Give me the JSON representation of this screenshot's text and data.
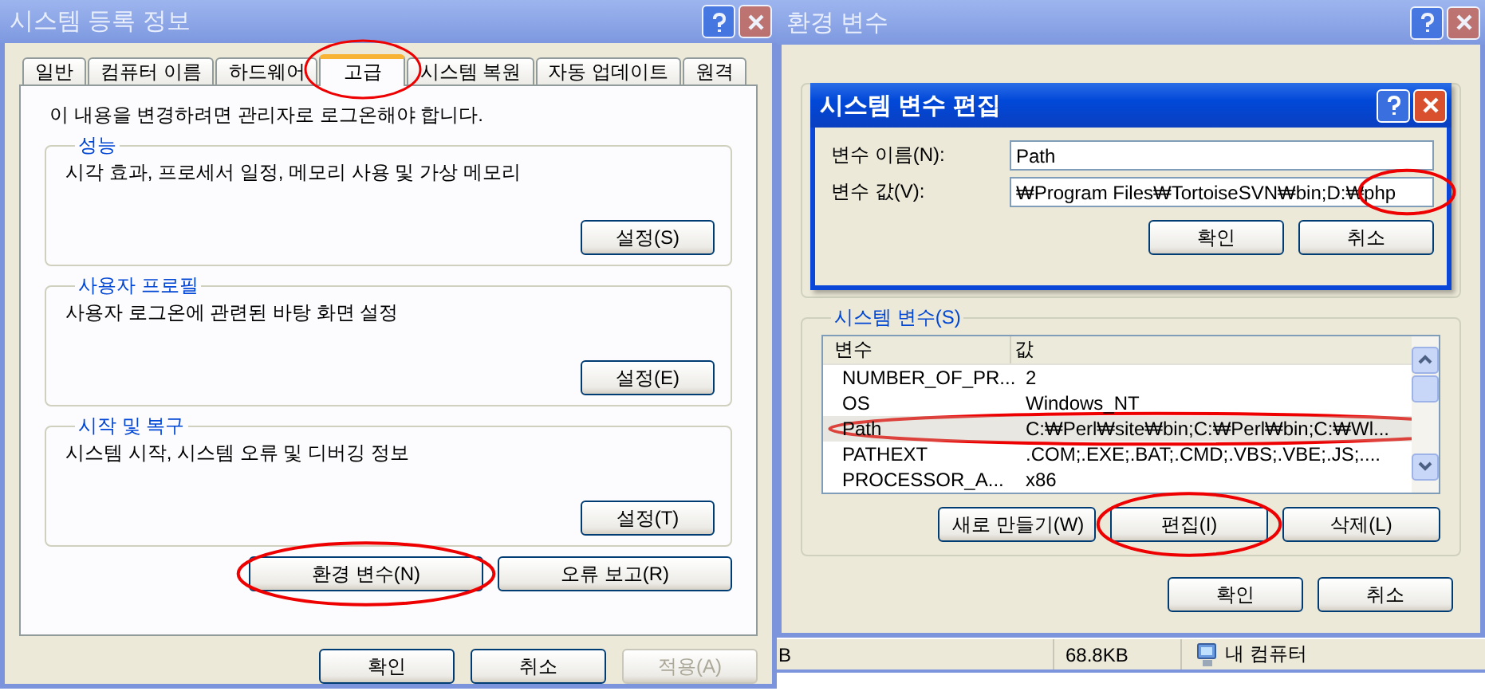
{
  "system_properties": {
    "title": "시스템 등록 정보",
    "tabs": [
      {
        "label": "일반",
        "selected": false,
        "highlighted": false
      },
      {
        "label": "컴퓨터 이름",
        "selected": false,
        "highlighted": false
      },
      {
        "label": "하드웨어",
        "selected": false,
        "highlighted": false
      },
      {
        "label": "고급",
        "selected": true,
        "highlighted": true
      },
      {
        "label": "시스템 복원",
        "selected": false,
        "highlighted": false
      },
      {
        "label": "자동 업데이트",
        "selected": false,
        "highlighted": false
      },
      {
        "label": "원격",
        "selected": false,
        "highlighted": false
      }
    ],
    "notice": "이 내용을 변경하려면 관리자로 로그온해야 합니다.",
    "groups": [
      {
        "title": "성능",
        "description": "시각 효과, 프로세서 일정, 메모리 사용 및 가상 메모리",
        "button": "설정(S)"
      },
      {
        "title": "사용자 프로필",
        "description": "사용자 로그온에 관련된 바탕 화면 설정",
        "button": "설정(E)"
      },
      {
        "title": "시작 및 복구",
        "description": "시스템 시작, 시스템 오류 및 디버깅 정보",
        "button": "설정(T)"
      }
    ],
    "actions": [
      {
        "label": "환경 변수(N)",
        "highlighted": true
      },
      {
        "label": "오류 보고(R)",
        "highlighted": false
      }
    ],
    "footer": [
      {
        "label": "확인",
        "disabled": false
      },
      {
        "label": "취소",
        "disabled": false
      },
      {
        "label": "적용(A)",
        "disabled": true
      }
    ]
  },
  "environment_variables": {
    "title": "환경 변수",
    "system_group": {
      "title": "시스템 변수(S)",
      "columns": [
        "변수",
        "값"
      ],
      "rows": [
        {
          "name": "NUMBER_OF_PR...",
          "value": "2",
          "selected": false,
          "highlighted": false
        },
        {
          "name": "OS",
          "value": "Windows_NT",
          "selected": false,
          "highlighted": false
        },
        {
          "name": "Path",
          "value": "C:₩Perl₩site₩bin;C:₩Perl₩bin;C:₩Wl...",
          "selected": true,
          "highlighted": true
        },
        {
          "name": "PATHEXT",
          "value": ".COM;.EXE;.BAT;.CMD;.VBS;.VBE;.JS;....",
          "selected": false,
          "highlighted": false
        },
        {
          "name": "PROCESSOR_A...",
          "value": "x86",
          "selected": false,
          "highlighted": false
        }
      ],
      "buttons": [
        {
          "label": "새로 만들기(W)",
          "highlighted": false
        },
        {
          "label": "편집(I)",
          "highlighted": true
        },
        {
          "label": "삭제(L)",
          "highlighted": false
        }
      ]
    },
    "footer": [
      "확인",
      "취소"
    ]
  },
  "edit_dialog": {
    "title": "시스템 변수 편집",
    "fields": [
      {
        "label": "변수 이름(N):",
        "value": "Path",
        "highlighted": false
      },
      {
        "label": "변수 값(V):",
        "value": "₩Program Files₩TortoiseSVN₩bin;D:₩php",
        "highlighted": true
      }
    ],
    "buttons": [
      "확인",
      "취소"
    ]
  },
  "status_bar": {
    "cells": [
      "B",
      "68.8KB"
    ],
    "location": "내 컴퓨터"
  }
}
